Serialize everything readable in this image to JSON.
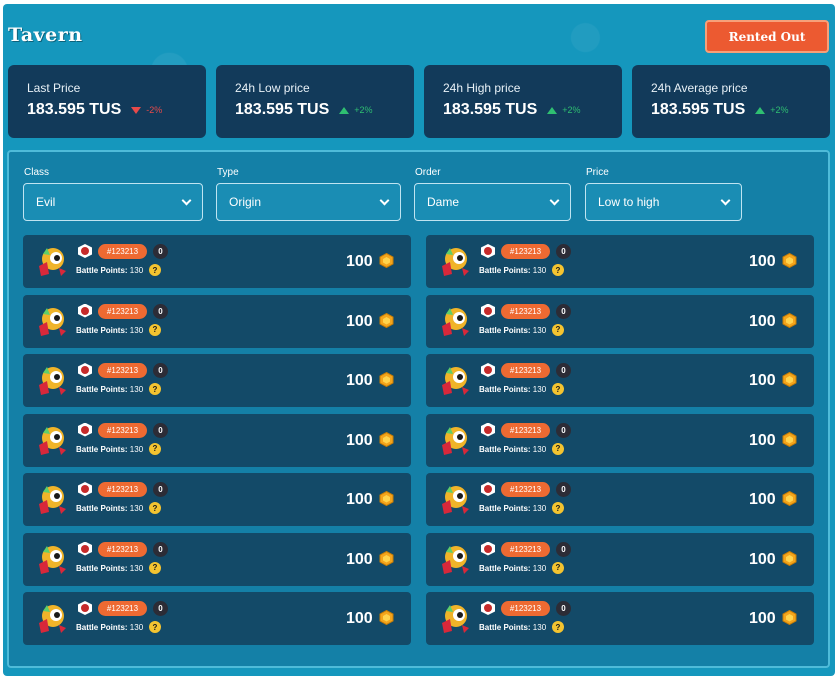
{
  "title": "Tavern",
  "rented_out_label": "Rented Out",
  "stats": [
    {
      "label": "Last Price",
      "value": "183.595 TUS",
      "change": "-2%",
      "direction": "down"
    },
    {
      "label": "24h Low price",
      "value": "183.595 TUS",
      "change": "+2%",
      "direction": "up"
    },
    {
      "label": "24h High price",
      "value": "183.595 TUS",
      "change": "+2%",
      "direction": "up"
    },
    {
      "label": "24h Average price",
      "value": "183.595 TUS",
      "change": "+2%",
      "direction": "up"
    }
  ],
  "filters": [
    {
      "label": "Class",
      "value": "Evil"
    },
    {
      "label": "Type",
      "value": "Origin"
    },
    {
      "label": "Order",
      "value": "Dame"
    },
    {
      "label": "Price",
      "value": "Low to high"
    }
  ],
  "colors": {
    "background": "#1597bd",
    "card": "#123a5a",
    "accent": "#ec5a31",
    "up": "#2fbf71",
    "down": "#e84a4a"
  },
  "items": [
    {
      "id": "#123213",
      "level": "0",
      "bp_label": "Battle Points:",
      "bp_value": "130",
      "help": "?",
      "price": "100"
    },
    {
      "id": "#123213",
      "level": "0",
      "bp_label": "Battle Points:",
      "bp_value": "130",
      "help": "?",
      "price": "100"
    },
    {
      "id": "#123213",
      "level": "0",
      "bp_label": "Battle Points:",
      "bp_value": "130",
      "help": "?",
      "price": "100"
    },
    {
      "id": "#123213",
      "level": "0",
      "bp_label": "Battle Points:",
      "bp_value": "130",
      "help": "?",
      "price": "100"
    },
    {
      "id": "#123213",
      "level": "0",
      "bp_label": "Battle Points:",
      "bp_value": "130",
      "help": "?",
      "price": "100"
    },
    {
      "id": "#123213",
      "level": "0",
      "bp_label": "Battle Points:",
      "bp_value": "130",
      "help": "?",
      "price": "100"
    },
    {
      "id": "#123213",
      "level": "0",
      "bp_label": "Battle Points:",
      "bp_value": "130",
      "help": "?",
      "price": "100"
    },
    {
      "id": "#123213",
      "level": "0",
      "bp_label": "Battle Points:",
      "bp_value": "130",
      "help": "?",
      "price": "100"
    },
    {
      "id": "#123213",
      "level": "0",
      "bp_label": "Battle Points:",
      "bp_value": "130",
      "help": "?",
      "price": "100"
    },
    {
      "id": "#123213",
      "level": "0",
      "bp_label": "Battle Points:",
      "bp_value": "130",
      "help": "?",
      "price": "100"
    },
    {
      "id": "#123213",
      "level": "0",
      "bp_label": "Battle Points:",
      "bp_value": "130",
      "help": "?",
      "price": "100"
    },
    {
      "id": "#123213",
      "level": "0",
      "bp_label": "Battle Points:",
      "bp_value": "130",
      "help": "?",
      "price": "100"
    },
    {
      "id": "#123213",
      "level": "0",
      "bp_label": "Battle Points:",
      "bp_value": "130",
      "help": "?",
      "price": "100"
    },
    {
      "id": "#123213",
      "level": "0",
      "bp_label": "Battle Points:",
      "bp_value": "130",
      "help": "?",
      "price": "100"
    }
  ]
}
